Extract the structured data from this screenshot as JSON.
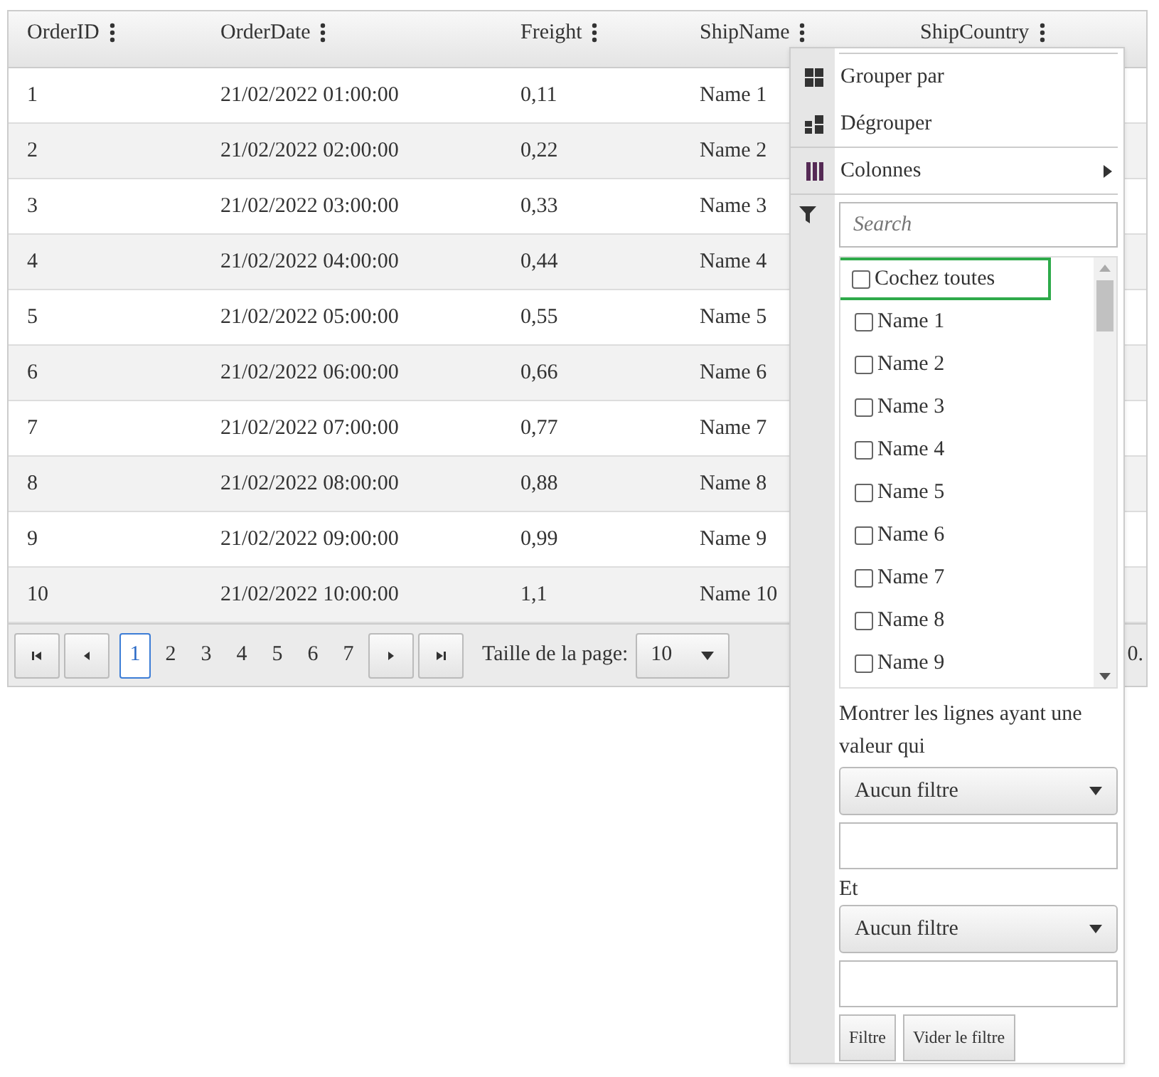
{
  "grid": {
    "columns": [
      {
        "label": "OrderID"
      },
      {
        "label": "OrderDate"
      },
      {
        "label": "Freight"
      },
      {
        "label": "ShipName"
      },
      {
        "label": "ShipCountry"
      }
    ],
    "rows": [
      [
        "1",
        "21/02/2022 01:00:00",
        "0,11",
        "Name 1"
      ],
      [
        "2",
        "21/02/2022 02:00:00",
        "0,22",
        "Name 2"
      ],
      [
        "3",
        "21/02/2022 03:00:00",
        "0,33",
        "Name 3"
      ],
      [
        "4",
        "21/02/2022 04:00:00",
        "0,44",
        "Name 4"
      ],
      [
        "5",
        "21/02/2022 05:00:00",
        "0,55",
        "Name 5"
      ],
      [
        "6",
        "21/02/2022 06:00:00",
        "0,66",
        "Name 6"
      ],
      [
        "7",
        "21/02/2022 07:00:00",
        "0,77",
        "Name 7"
      ],
      [
        "8",
        "21/02/2022 08:00:00",
        "0,88",
        "Name 8"
      ],
      [
        "9",
        "21/02/2022 09:00:00",
        "0,99",
        "Name 9"
      ],
      [
        "10",
        "21/02/2022 10:00:00",
        "1,1",
        "Name 10"
      ]
    ]
  },
  "pager": {
    "pages": [
      {
        "label": "1",
        "selected": true
      },
      {
        "label": "2",
        "selected": false
      },
      {
        "label": "3",
        "selected": false
      },
      {
        "label": "4",
        "selected": false
      },
      {
        "label": "5",
        "selected": false
      },
      {
        "label": "6",
        "selected": false
      },
      {
        "label": "7",
        "selected": false
      }
    ],
    "page_size_label": "Taille de la page:",
    "page_size": "10",
    "info": "0."
  },
  "column_menu": {
    "items": [
      {
        "label": "Grouper par",
        "submenu": false
      },
      {
        "label": "Dégrouper",
        "submenu": false
      },
      {
        "label": "Colonnes",
        "submenu": true
      }
    ],
    "filter": {
      "search_placeholder": "Search",
      "options": [
        {
          "label": "Cochez toutes",
          "checked": false,
          "focused": true
        },
        {
          "label": "Name 1",
          "checked": false,
          "focused": false
        },
        {
          "label": "Name 2",
          "checked": false,
          "focused": false
        },
        {
          "label": "Name 3",
          "checked": false,
          "focused": false
        },
        {
          "label": "Name 4",
          "checked": false,
          "focused": false
        },
        {
          "label": "Name 5",
          "checked": false,
          "focused": false
        },
        {
          "label": "Name 6",
          "checked": false,
          "focused": false
        },
        {
          "label": "Name 7",
          "checked": false,
          "focused": false
        },
        {
          "label": "Name 8",
          "checked": false,
          "focused": false
        },
        {
          "label": "Name 9",
          "checked": false,
          "focused": false
        }
      ],
      "condition_label": "Montrer les lignes ayant une valeur qui",
      "operator_1": "Aucun filtre",
      "joiner": "Et",
      "operator_2": "Aucun filtre",
      "buttons": [
        "Filtre",
        "Vider le filtre"
      ]
    }
  }
}
